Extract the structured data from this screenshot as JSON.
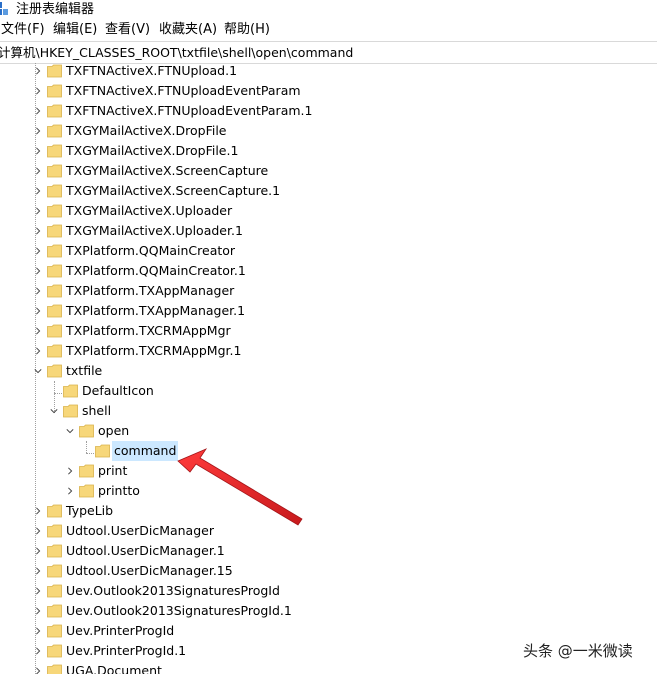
{
  "window": {
    "title": "注册表编辑器"
  },
  "menu": [
    "文件(F)",
    "编辑(E)",
    "查看(V)",
    "收藏夹(A)",
    "帮助(H)"
  ],
  "address": "计算机\\HKEY_CLASSES_ROOT\\txtfile\\shell\\open\\command",
  "tree": {
    "top_keys": [
      "TXFTNActiveX.FTNUpload.1",
      "TXFTNActiveX.FTNUploadEventParam",
      "TXFTNActiveX.FTNUploadEventParam.1",
      "TXGYMailActiveX.DropFile",
      "TXGYMailActiveX.DropFile.1",
      "TXGYMailActiveX.ScreenCapture",
      "TXGYMailActiveX.ScreenCapture.1",
      "TXGYMailActiveX.Uploader",
      "TXGYMailActiveX.Uploader.1",
      "TXPlatform.QQMainCreator",
      "TXPlatform.QQMainCreator.1",
      "TXPlatform.TXAppManager",
      "TXPlatform.TXAppManager.1",
      "TXPlatform.TXCRMAppMgr",
      "TXPlatform.TXCRMAppMgr.1"
    ],
    "txtfile": {
      "label": "txtfile",
      "default_icon": "DefaultIcon",
      "shell": "shell",
      "open": "open",
      "command": "command",
      "print": "print",
      "printto": "printto"
    },
    "bottom_keys": [
      "TypeLib",
      "Udtool.UserDicManager",
      "Udtool.UserDicManager.1",
      "Udtool.UserDicManager.15",
      "Uev.Outlook2013SignaturesProgId",
      "Uev.Outlook2013SignaturesProgId.1",
      "Uev.PrinterProgId",
      "Uev.PrinterProgId.1",
      "UGA.Document"
    ]
  },
  "watermark": "头条 @一米微读",
  "colors": {
    "folder": "#f7d77a",
    "selection": "#cce8ff",
    "arrow": "#e8282b"
  }
}
